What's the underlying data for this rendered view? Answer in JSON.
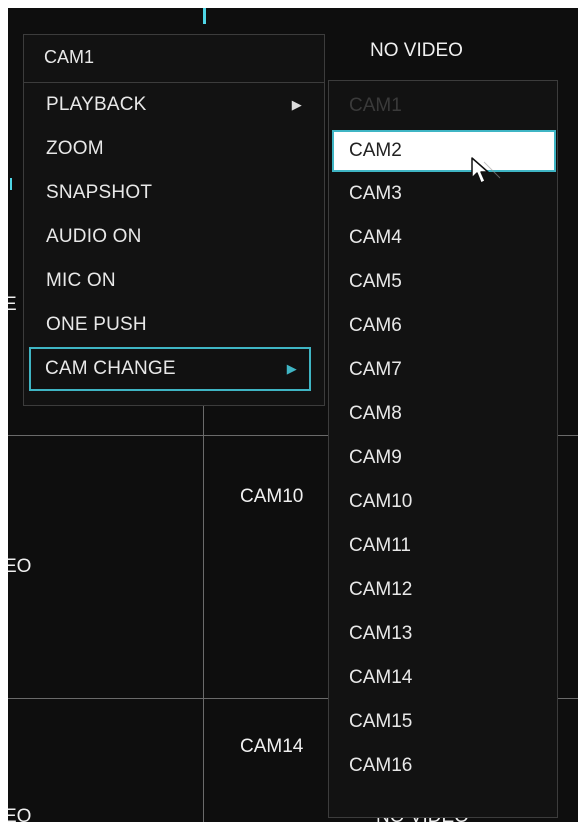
{
  "context_menu": {
    "title": "CAM1",
    "items": [
      {
        "label": "PLAYBACK",
        "has_submenu": true,
        "selected": false
      },
      {
        "label": "ZOOM",
        "has_submenu": false,
        "selected": false
      },
      {
        "label": "SNAPSHOT",
        "has_submenu": false,
        "selected": false
      },
      {
        "label": "AUDIO ON",
        "has_submenu": false,
        "selected": false
      },
      {
        "label": "MIC ON",
        "has_submenu": false,
        "selected": false
      },
      {
        "label": "ONE PUSH",
        "has_submenu": false,
        "selected": false
      },
      {
        "label": "CAM CHANGE",
        "has_submenu": true,
        "selected": true
      }
    ],
    "arrow_glyph": "▶"
  },
  "submenu": {
    "items": [
      {
        "label": "CAM1",
        "state": "disabled"
      },
      {
        "label": "CAM2",
        "state": "hover"
      },
      {
        "label": "CAM3",
        "state": "normal"
      },
      {
        "label": "CAM4",
        "state": "normal"
      },
      {
        "label": "CAM5",
        "state": "normal"
      },
      {
        "label": "CAM6",
        "state": "normal"
      },
      {
        "label": "CAM7",
        "state": "normal"
      },
      {
        "label": "CAM8",
        "state": "normal"
      },
      {
        "label": "CAM9",
        "state": "normal"
      },
      {
        "label": "CAM10",
        "state": "normal"
      },
      {
        "label": "CAM11",
        "state": "normal"
      },
      {
        "label": "CAM12",
        "state": "normal"
      },
      {
        "label": "CAM13",
        "state": "normal"
      },
      {
        "label": "CAM14",
        "state": "normal"
      },
      {
        "label": "CAM15",
        "state": "normal"
      },
      {
        "label": "CAM16",
        "state": "normal"
      }
    ]
  },
  "background_cells": {
    "top_right": "NO VIDEO",
    "mid_left_partial": "EO",
    "left_partial_top": "E",
    "mid_center_partial": "CAM10",
    "bottom_center_partial": "CAM14",
    "bottom_right_partial": "NO VIDEO",
    "bottom_left_partial": "EO"
  },
  "colors": {
    "accent": "#3fb5c4",
    "menu_bg": "#121212",
    "screen_bg": "#0e0e0e",
    "text": "#e8e8e8",
    "disabled_text": "#3a3a3a"
  }
}
